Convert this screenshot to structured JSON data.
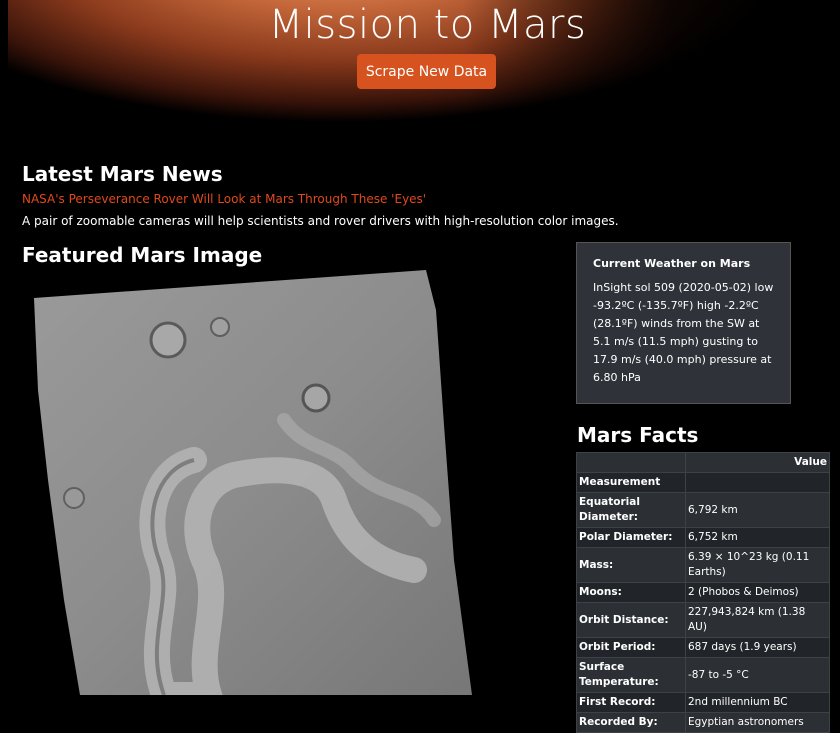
{
  "header": {
    "title": "Mission to Mars",
    "scrape_button": "Scrape New Data"
  },
  "news": {
    "heading": "Latest Mars News",
    "title": "NASA's Perseverance Rover Will Look at Mars Through These 'Eyes'",
    "paragraph": "A pair of zoomable cameras will help scientists and rover drivers with high-resolution color images."
  },
  "featured": {
    "heading": "Featured Mars Image"
  },
  "weather": {
    "title": "Current Weather on Mars",
    "text": "InSight sol 509 (2020-05-02) low -93.2ºC (-135.7ºF) high -2.2ºC (28.1ºF) winds from the SW at 5.1 m/s (11.5 mph) gusting to 17.9 m/s (40.0 mph) pressure at 6.80 hPa"
  },
  "facts": {
    "heading": "Mars Facts",
    "col_value": "Value",
    "col_measurement": "Measurement",
    "rows": [
      {
        "label": "Equatorial Diameter:",
        "value": "6,792 km"
      },
      {
        "label": "Polar Diameter:",
        "value": "6,752 km"
      },
      {
        "label": "Mass:",
        "value": "6.39 × 10^23 kg (0.11 Earths)"
      },
      {
        "label": "Moons:",
        "value": "2 (Phobos & Deimos)"
      },
      {
        "label": "Orbit Distance:",
        "value": "227,943,824 km (1.38 AU)"
      },
      {
        "label": "Orbit Period:",
        "value": "687 days (1.9 years)"
      },
      {
        "label": "Surface Temperature:",
        "value": "-87 to -5 °C"
      },
      {
        "label": "First Record:",
        "value": "2nd millennium BC"
      },
      {
        "label": "Recorded By:",
        "value": "Egyptian astronomers"
      }
    ]
  }
}
